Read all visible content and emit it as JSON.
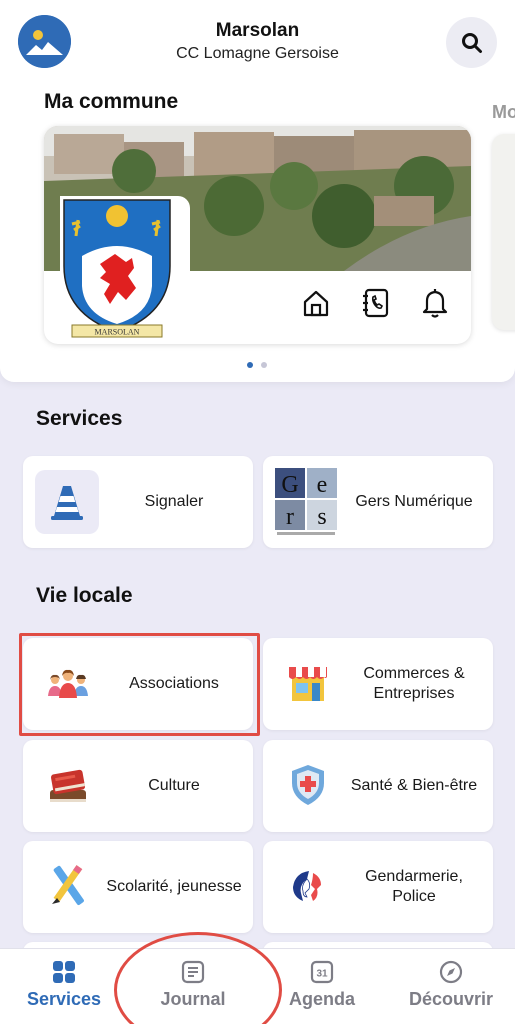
{
  "header": {
    "city": "Marsolan",
    "community": "CC Lomagne Gersoise",
    "logo_icon": "commune-logo-icon",
    "search_icon": "search-icon"
  },
  "commune": {
    "title": "Ma commune",
    "next_title": "Mo",
    "crest_text": "MARSOLAN",
    "icons": [
      "home-icon",
      "contact-book-icon",
      "bell-icon"
    ],
    "carousel_pages": 2,
    "carousel_active": 1
  },
  "services": {
    "title": "Services",
    "items": [
      {
        "label": "Signaler",
        "icon": "traffic-cone-icon"
      },
      {
        "label": "Gers Numérique",
        "icon": "gers-numerique-logo"
      }
    ]
  },
  "vie_locale": {
    "title": "Vie locale",
    "items": [
      {
        "label": "Associations",
        "icon": "people-group-icon"
      },
      {
        "label": "Commerces & Entreprises",
        "icon": "shop-icon"
      },
      {
        "label": "Culture",
        "icon": "books-icon"
      },
      {
        "label": "Santé & Bien-être",
        "icon": "medical-shield-icon"
      },
      {
        "label": "Scolarité, jeunesse",
        "icon": "pencil-ruler-icon"
      },
      {
        "label": "Gendarmerie, Police",
        "icon": "marianne-icon"
      }
    ]
  },
  "bottom_nav": {
    "items": [
      {
        "label": "Services",
        "icon": "grid-icon",
        "active": true
      },
      {
        "label": "Journal",
        "icon": "journal-icon",
        "active": false
      },
      {
        "label": "Agenda",
        "icon": "calendar-icon",
        "active": false,
        "icon_text": "31"
      },
      {
        "label": "Découvrir",
        "icon": "compass-icon",
        "active": false
      }
    ]
  },
  "colors": {
    "accent": "#2f6bb6",
    "background": "#ebeaf6",
    "annotation_red": "#e04c44"
  }
}
